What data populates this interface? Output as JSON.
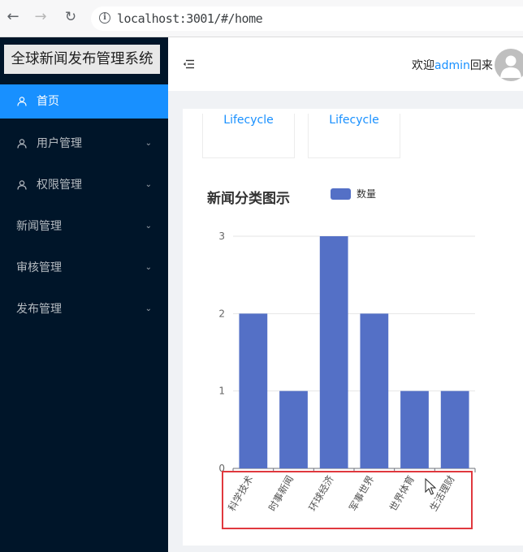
{
  "browser": {
    "url": "localhost:3001/#/home",
    "icons": [
      "back-arrow-icon",
      "forward-arrow-icon",
      "reload-icon",
      "info-icon"
    ]
  },
  "sidebar": {
    "title": "全球新闻发布管理系统",
    "items": [
      {
        "label": "首页",
        "icon": "user-icon",
        "active": true,
        "expandable": false
      },
      {
        "label": "用户管理",
        "icon": "user-icon",
        "active": false,
        "expandable": true
      },
      {
        "label": "权限管理",
        "icon": "user-icon",
        "active": false,
        "expandable": true
      },
      {
        "label": "新闻管理",
        "icon": "",
        "active": false,
        "expandable": true
      },
      {
        "label": "审核管理",
        "icon": "",
        "active": false,
        "expandable": true
      },
      {
        "label": "发布管理",
        "icon": "",
        "active": false,
        "expandable": true
      }
    ]
  },
  "header": {
    "welcome_prefix": "欢迎",
    "username": "admin",
    "welcome_suffix": "回来"
  },
  "cards": [
    {
      "label": "Lifecycle"
    },
    {
      "label": "Lifecycle"
    }
  ],
  "colors": {
    "sidebar_bg": "#001529",
    "active_item": "#1890ff",
    "bar": "#5470c6",
    "highlight": "#e0383e"
  },
  "chart_data": {
    "type": "bar",
    "title": "新闻分类图示",
    "legend": "top",
    "series": [
      {
        "name": "数量",
        "values": [
          2,
          1,
          3,
          2,
          1,
          1
        ]
      }
    ],
    "categories": [
      "科学技术",
      "时事新闻",
      "环球经济",
      "军事世界",
      "世界体育",
      "生活理财"
    ],
    "ylim": [
      0,
      3
    ],
    "yticks": [
      0,
      1,
      2,
      3
    ],
    "grid": true
  }
}
